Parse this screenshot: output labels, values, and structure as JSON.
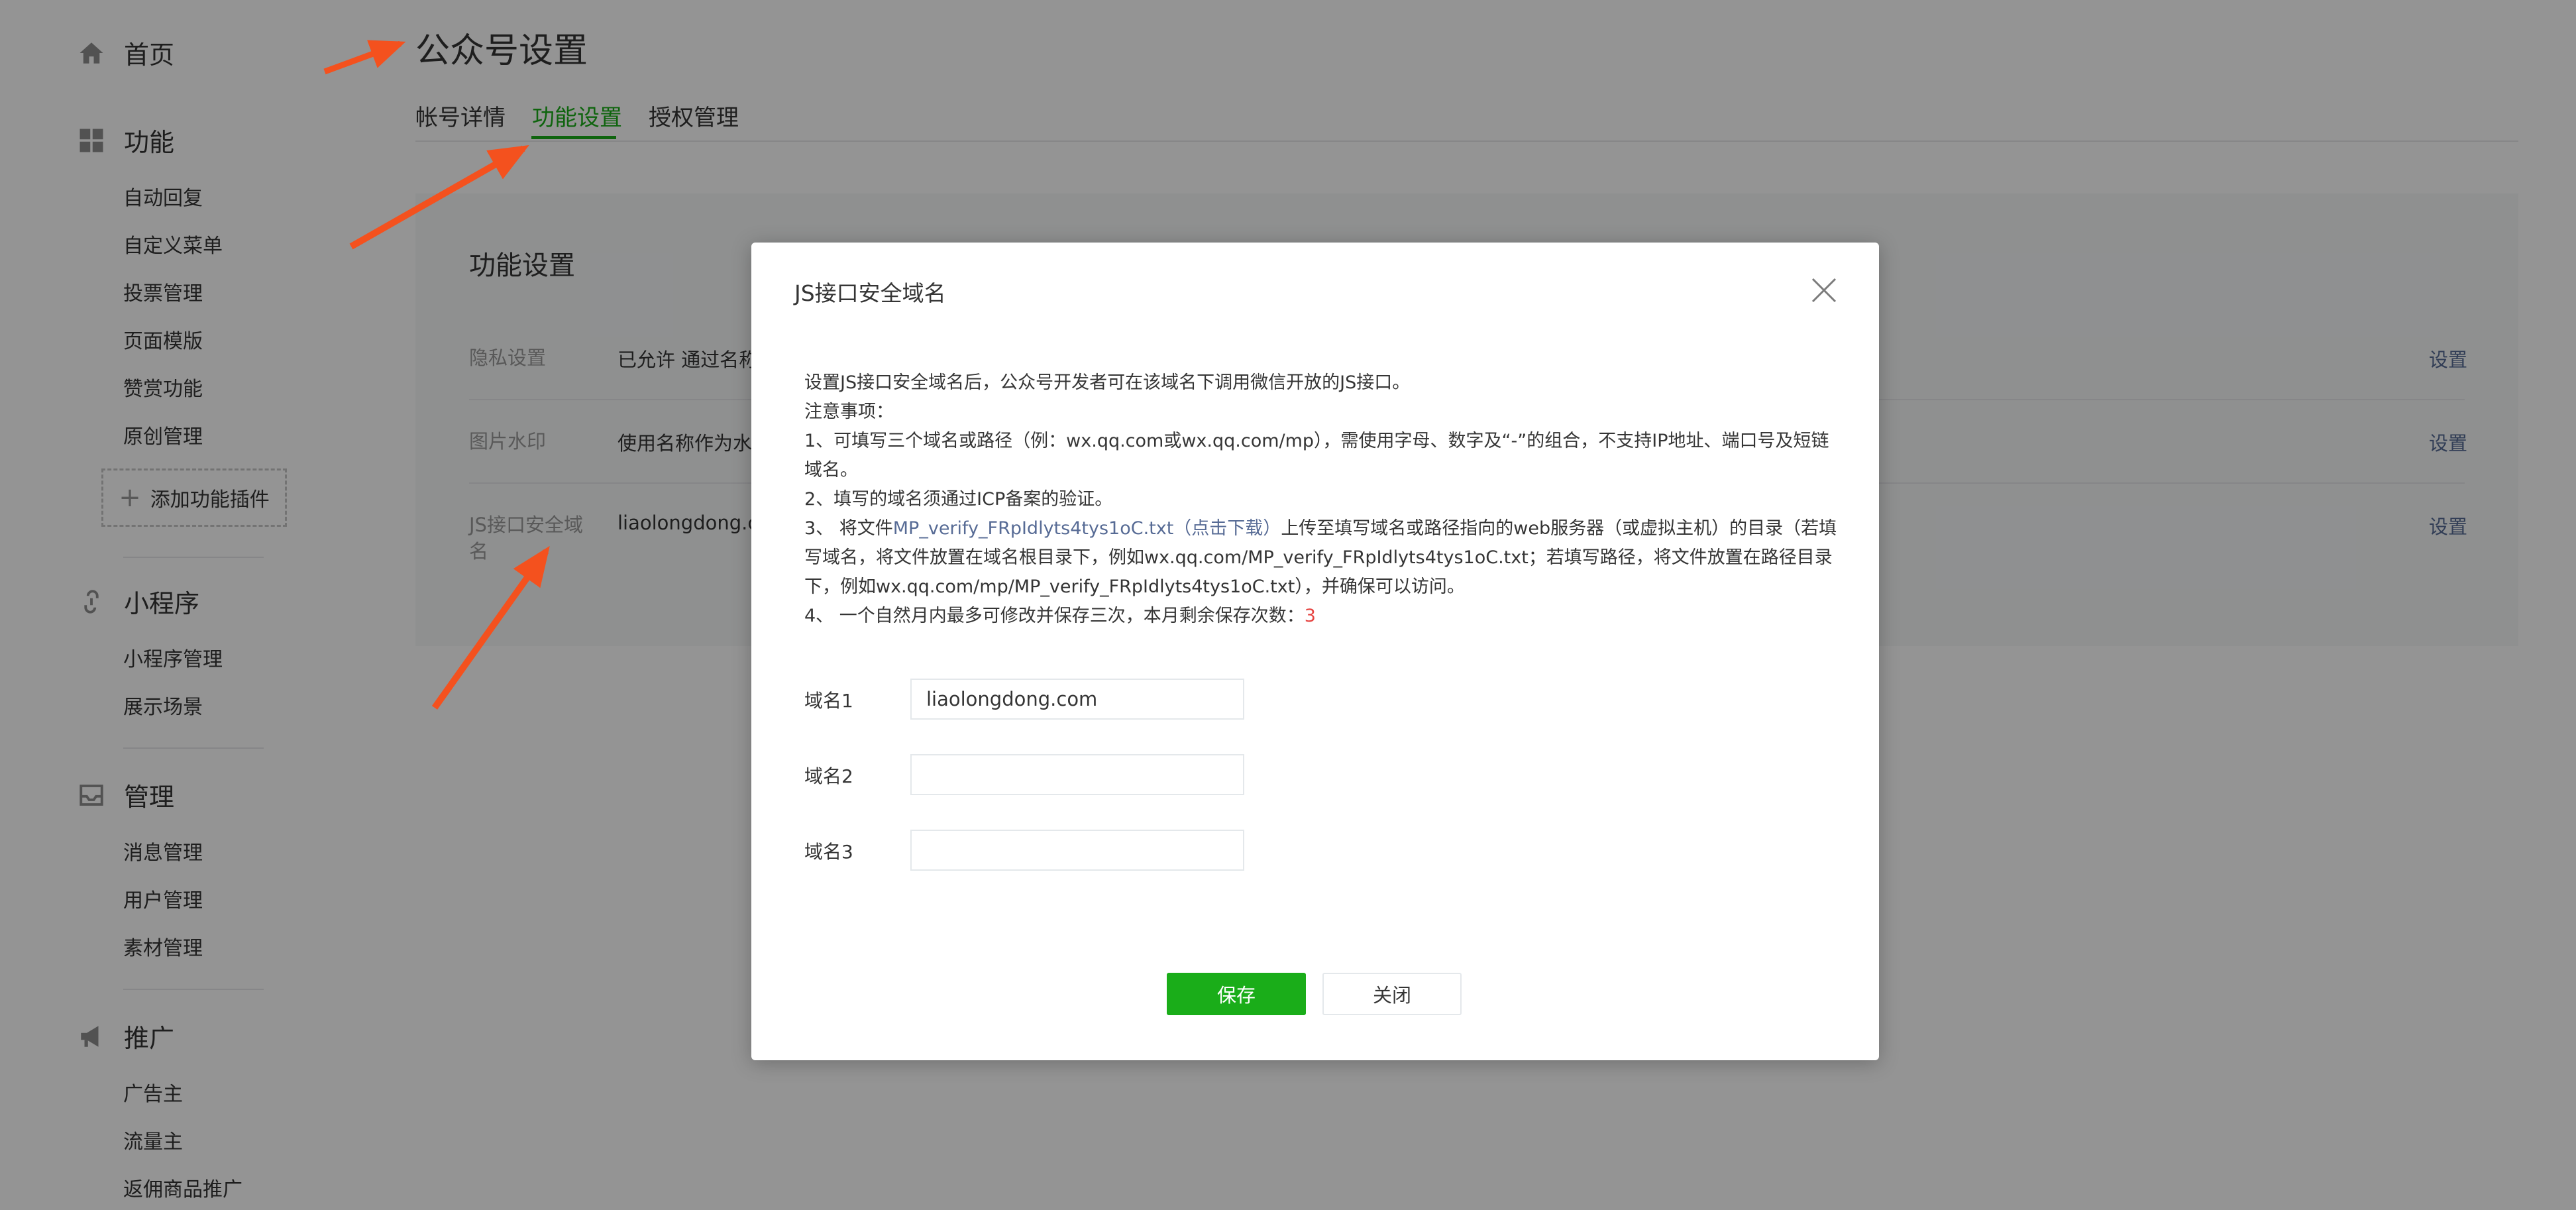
{
  "sidebar": {
    "home": "首页",
    "function": {
      "title": "功能",
      "items": [
        "自动回复",
        "自定义菜单",
        "投票管理",
        "页面模版",
        "赞赏功能",
        "原创管理"
      ],
      "add_plugin": "添加功能插件"
    },
    "miniprogram": {
      "title": "小程序",
      "items": [
        "小程序管理",
        "展示场景"
      ]
    },
    "manage": {
      "title": "管理",
      "items": [
        "消息管理",
        "用户管理",
        "素材管理"
      ]
    },
    "promote": {
      "title": "推广",
      "items": [
        "广告主",
        "流量主",
        "返佣商品推广"
      ]
    }
  },
  "header": {
    "title": "公众号设置",
    "tabs": [
      "帐号详情",
      "功能设置",
      "授权管理"
    ],
    "active_tab": "功能设置"
  },
  "panel": {
    "title": "功能设置",
    "rows": [
      {
        "label": "隐私设置",
        "value": "已允许 通过名称",
        "action": "设置"
      },
      {
        "label": "图片水印",
        "value": "使用名称作为水印",
        "action": "设置"
      },
      {
        "label": "JS接口安全域名",
        "value": "liaolongdong.co",
        "action": "设置"
      }
    ]
  },
  "dialog": {
    "title": "JS接口安全域名",
    "intro": "设置JS接口安全域名后，公众号开发者可在该域名下调用微信开放的JS接口。",
    "notes_title": "注意事项：",
    "note1": "1、可填写三个域名或路径（例：wx.qq.com或wx.qq.com/mp），需使用字母、数字及“-”的组合，不支持IP地址、端口号及短链域名。",
    "note2": "2、填写的域名须通过ICP备案的验证。",
    "note3_prefix": "3、 将文件",
    "note3_link": "MP_verify_FRpIdlyts4tys1oC.txt（点击下载）",
    "note3_suffix": "上传至填写域名或路径指向的web服务器（或虚拟主机）的目录（若填写域名，将文件放置在域名根目录下，例如wx.qq.com/MP_verify_FRpIdlyts4tys1oC.txt；若填写路径，将文件放置在路径目录下，例如wx.qq.com/mp/MP_verify_FRpIdlyts4tys1oC.txt），并确保可以访问。",
    "note4_prefix": "4、 一个自然月内最多可修改并保存三次，本月剩余保存次数：",
    "note4_count": "3",
    "fields": [
      {
        "label": "域名1",
        "value": "liaolongdong.com"
      },
      {
        "label": "域名2",
        "value": ""
      },
      {
        "label": "域名3",
        "value": ""
      }
    ],
    "save_label": "保存",
    "close_label": "关闭"
  },
  "colors": {
    "accent_green": "#1aad19",
    "link_blue": "#576b95",
    "warning_red": "#e64340",
    "annotation_arrow": "#f4511e"
  },
  "icons": [
    "home-icon",
    "grid-icon",
    "link-icon",
    "inbox-icon",
    "megaphone-icon",
    "close-icon",
    "plus-icon"
  ]
}
